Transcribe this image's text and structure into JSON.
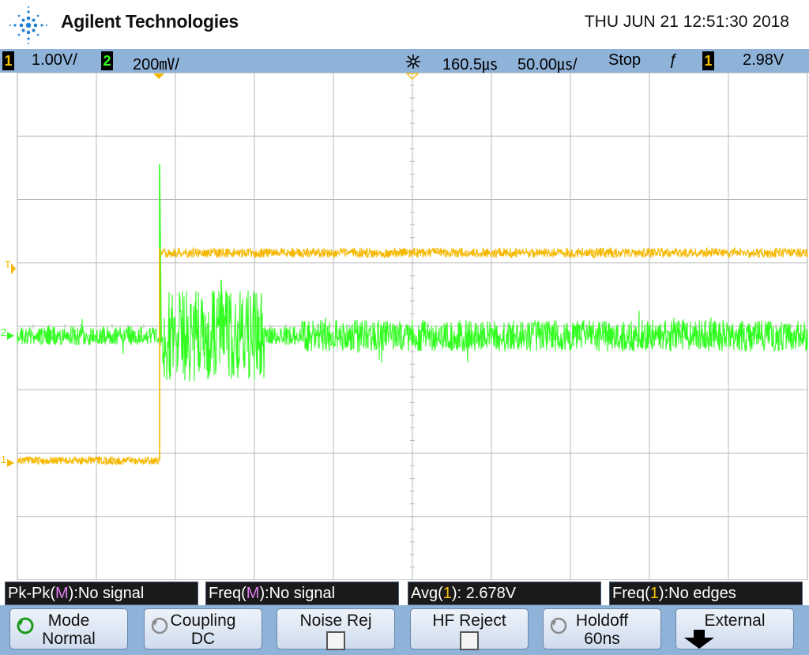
{
  "header": {
    "brand": "Agilent Technologies",
    "datetime": "THU JUN 21 12:51:30 2018"
  },
  "status": {
    "ch1_num": "1",
    "ch1_scale": "1.00V/",
    "ch2_num": "2",
    "ch2_scale": "200㎷/",
    "delay": "160.5㎲",
    "timebase": "50.00㎲/",
    "run_state": "Stop",
    "trigger_edge": "ƒ",
    "trig_ch": "1",
    "trigger_level": "2.98V"
  },
  "markers": {
    "trigger": "T",
    "ch2": "2",
    "ch1": "1"
  },
  "measurements": [
    {
      "pre": "Pk-Pk(",
      "src": "M",
      "post": "):No signal"
    },
    {
      "pre": "Freq(",
      "src": "M",
      "post": "):No signal"
    },
    {
      "pre": "Avg(",
      "src": "1",
      "post": "): 2.678V"
    },
    {
      "pre": "Freq(",
      "src": "1",
      "post": "):No edges"
    }
  ],
  "softkeys": {
    "mode_title": "Mode",
    "mode_value": "Normal",
    "coupling_title": "Coupling",
    "coupling_value": "DC",
    "noise_title": "Noise Rej",
    "hf_title": "HF Reject",
    "holdoff_title": "Holdoff",
    "holdoff_value": "60ns",
    "source_title": "External"
  },
  "colors": {
    "ch1": "#f5b800",
    "ch2": "#33ff22",
    "bar": "#8fb2d8",
    "grid": "#b8b8b8"
  },
  "chart_data": {
    "type": "line",
    "series": [
      {
        "name": "1",
        "x": [
          -250,
          -160,
          -160,
          250
        ],
        "values": [
          -2.1,
          -2.1,
          0.8,
          0.8
        ]
      },
      {
        "name": "2",
        "x": [
          -250,
          -160,
          -150,
          -90,
          -40,
          250
        ],
        "values": [
          0,
          0.85,
          0.4,
          0.4,
          0.1,
          0.1
        ]
      }
    ]
  }
}
